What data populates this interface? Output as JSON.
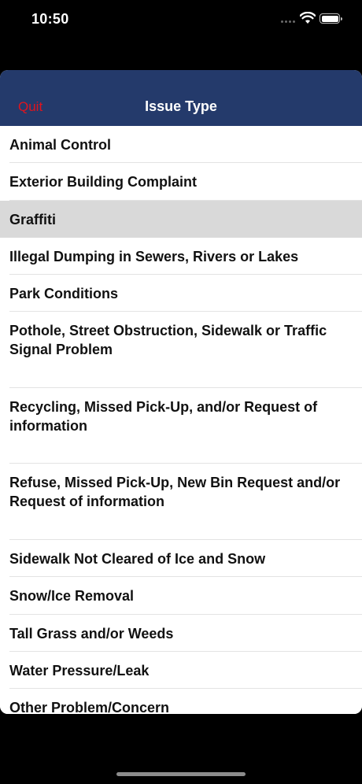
{
  "status_bar": {
    "time": "10:50"
  },
  "nav": {
    "quit_label": "Quit",
    "title": "Issue Type"
  },
  "issues": [
    {
      "label": "Animal Control",
      "selected": false
    },
    {
      "label": "Exterior Building Complaint",
      "selected": false
    },
    {
      "label": "Graffiti",
      "selected": true
    },
    {
      "label": "Illegal Dumping in Sewers, Rivers or Lakes",
      "selected": false
    },
    {
      "label": "Park Conditions",
      "selected": false
    },
    {
      "label": "Pothole, Street Obstruction, Sidewalk or Traffic Signal Problem",
      "selected": false
    },
    {
      "label": "Recycling, Missed Pick-Up, and/or Request of information",
      "selected": false
    },
    {
      "label": "Refuse, Missed Pick-Up, New Bin Request and/or Request of information",
      "selected": false
    },
    {
      "label": "Sidewalk Not Cleared of Ice and Snow",
      "selected": false
    },
    {
      "label": "Snow/Ice Removal",
      "selected": false
    },
    {
      "label": "Tall Grass and/or Weeds",
      "selected": false
    },
    {
      "label": "Water Pressure/Leak",
      "selected": false
    },
    {
      "label": "Other Problem/Concern",
      "selected": false
    }
  ]
}
